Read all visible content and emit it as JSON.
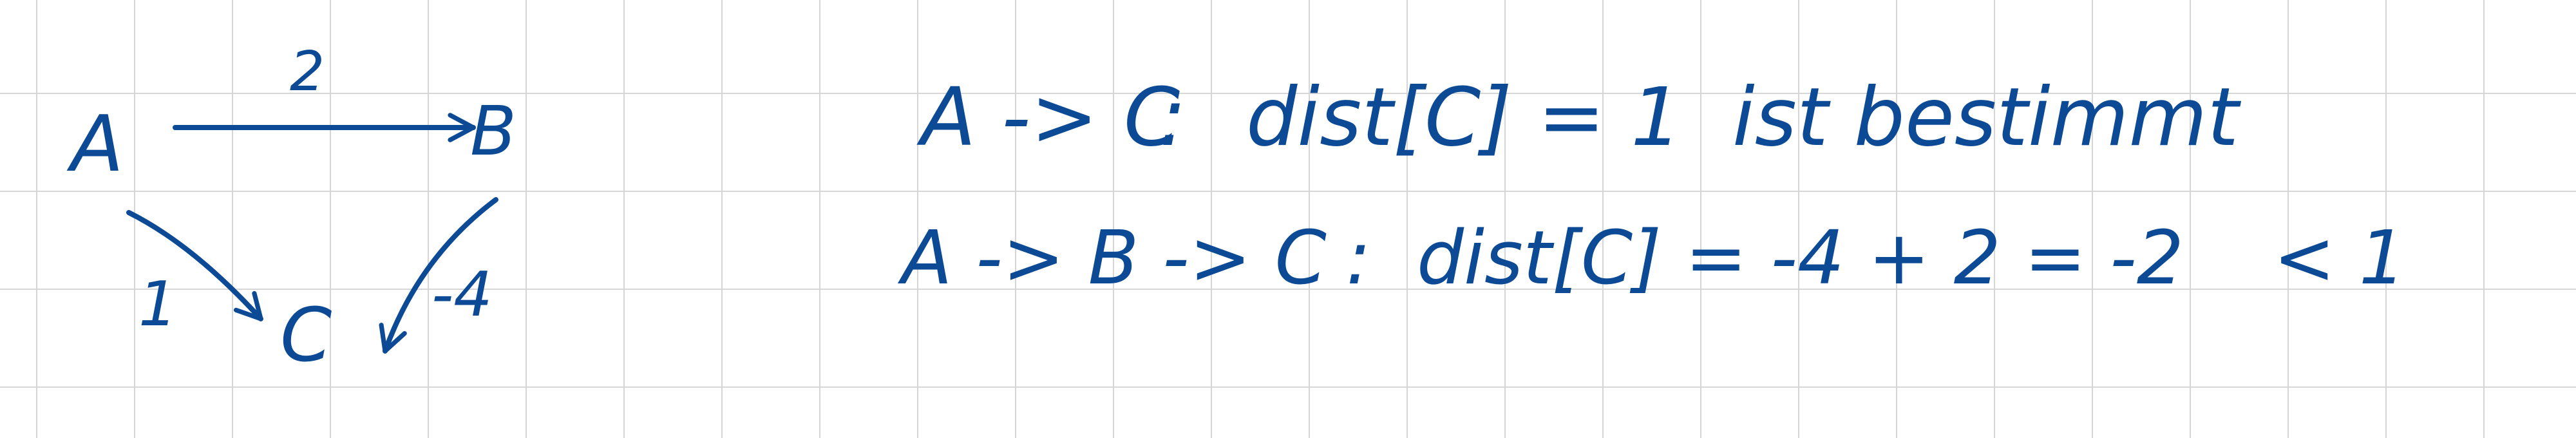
{
  "colors": {
    "ink": "#0d4a96",
    "grid": "#d6d6d6",
    "paper": "#ffffff"
  },
  "graph": {
    "nodes": {
      "a": "A",
      "b": "B",
      "c": "C"
    },
    "edges": [
      {
        "from": "A",
        "to": "B",
        "weight": "2"
      },
      {
        "from": "A",
        "to": "C",
        "weight": "1"
      },
      {
        "from": "B",
        "to": "C",
        "weight": "-4"
      }
    ]
  },
  "notes": {
    "line1": {
      "path": "A -> C",
      "sep": ":",
      "expr": "dist[C] = 1",
      "comment": "ist bestimmt"
    },
    "line2": {
      "path": "A -> B -> C",
      "sep": ":",
      "expr": "dist[C] = -4 + 2 = -2",
      "cmp": "< 1"
    }
  }
}
